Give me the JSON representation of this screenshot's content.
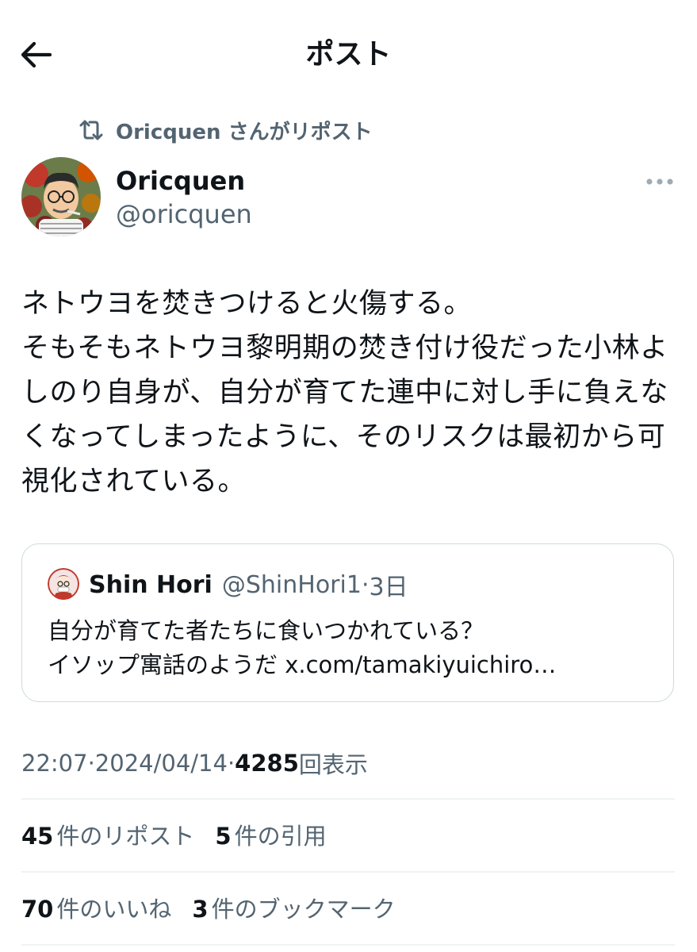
{
  "header": {
    "title": "ポスト"
  },
  "repost": {
    "text": "Oricquen さんがリポスト"
  },
  "author": {
    "name": "Oricquen",
    "handle": "@oricquen"
  },
  "tweet": {
    "lines": [
      "ネトウヨを焚きつけると火傷する。",
      "そもそもネトウヨ黎明期の焚き付け役だった小林よ",
      "しのり自身が、自分が育てた連中に対し手に負えな",
      "くなってしまったように、そのリスクは最初から可",
      "視化されている。"
    ]
  },
  "quote": {
    "name": "Shin Hori",
    "handle": "@ShinHori1",
    "dot": "·",
    "time": "3日",
    "line1": "自分が育てた者たちに食いつかれている？",
    "line2_text": "イソップ寓話のようだ ",
    "line2_link": "x.com/tamakiyuichiro…"
  },
  "meta": {
    "time": "22:07",
    "sep1": " · ",
    "date": "2024/04/14",
    "sep2": " · ",
    "views": "4285",
    "views_label": " 回表示"
  },
  "stats": {
    "reposts": {
      "count": "45",
      "label": "件のリポスト"
    },
    "quotes": {
      "count": "5",
      "label": "件の引用"
    },
    "likes": {
      "count": "70",
      "label": "件のいいね"
    },
    "bookmarks": {
      "count": "3",
      "label": "件のブックマーク"
    }
  },
  "colors": {
    "text": "#0f1419",
    "secondary": "#536471",
    "border": "#cfd9de",
    "divider": "#eff3f4"
  },
  "icons": {
    "back": "arrow-left-icon",
    "repost": "repost-icon",
    "more": "more-dots-icon"
  }
}
